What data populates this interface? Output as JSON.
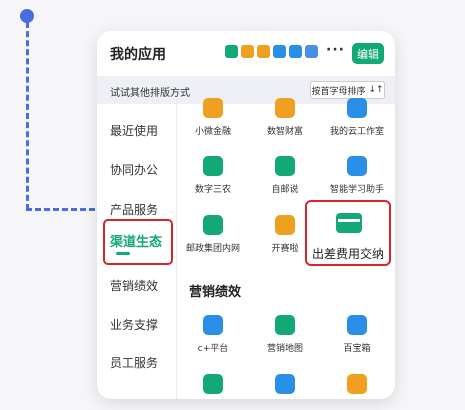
{
  "header": {
    "title": "我的应用",
    "more_label": "···",
    "edit_label": "编辑",
    "icon_colors": [
      "#13a875",
      "#f0a020",
      "#f0a020",
      "#2a8fe6",
      "#2a8fe6",
      "#4a90e2"
    ]
  },
  "sortbar": {
    "hint": "试试其他排版方式",
    "button_label": "按首字母排序",
    "button_icon": "↓↑"
  },
  "sidebar": {
    "items": [
      {
        "label": "最近使用"
      },
      {
        "label": "协同办公"
      },
      {
        "label": "产品服务"
      },
      {
        "label": "渠道生态"
      },
      {
        "label": "营销绩效"
      },
      {
        "label": "业务支撑"
      },
      {
        "label": "员工服务"
      }
    ],
    "active_index": 3
  },
  "apps": {
    "row1": [
      {
        "label": "小微金融",
        "icon": "coin-bag-icon",
        "color": "#f0a020"
      },
      {
        "label": "数智财富",
        "icon": "wallet-icon",
        "color": "#f0a020"
      },
      {
        "label": "我的云工作室",
        "icon": "cloud-icon",
        "color": "#2a8fe6"
      }
    ],
    "row2": [
      {
        "label": "数字三农",
        "icon": "database-icon",
        "color": "#13a875"
      },
      {
        "label": "自邮说",
        "icon": "chat-icon",
        "color": "#13a875"
      },
      {
        "label": "智能学习助手",
        "icon": "robot-icon",
        "color": "#2a8fe6"
      }
    ],
    "row3": [
      {
        "label": "邮政集团内网",
        "icon": "globe-icon",
        "color": "#13a875"
      },
      {
        "label": "开赛啦",
        "icon": "trophy-icon",
        "color": "#f0a020"
      },
      {
        "label": "出差费用交纳",
        "icon": "card-icon",
        "color": "#13a875"
      }
    ]
  },
  "section": {
    "title": "营销绩效",
    "row1": [
      {
        "label": "c+平台",
        "icon": "crm-icon",
        "color": "#2a8fe6"
      },
      {
        "label": "营销地图",
        "icon": "map-icon",
        "color": "#13a875"
      },
      {
        "label": "百宝箱",
        "icon": "cube-icon",
        "color": "#2a8fe6"
      }
    ],
    "row2": [
      {
        "label": "",
        "icon": "headset-icon",
        "color": "#13a875"
      },
      {
        "label": "",
        "icon": "document-icon",
        "color": "#2a8fe6"
      },
      {
        "label": "",
        "icon": "box-icon",
        "color": "#f0a020"
      }
    ]
  }
}
